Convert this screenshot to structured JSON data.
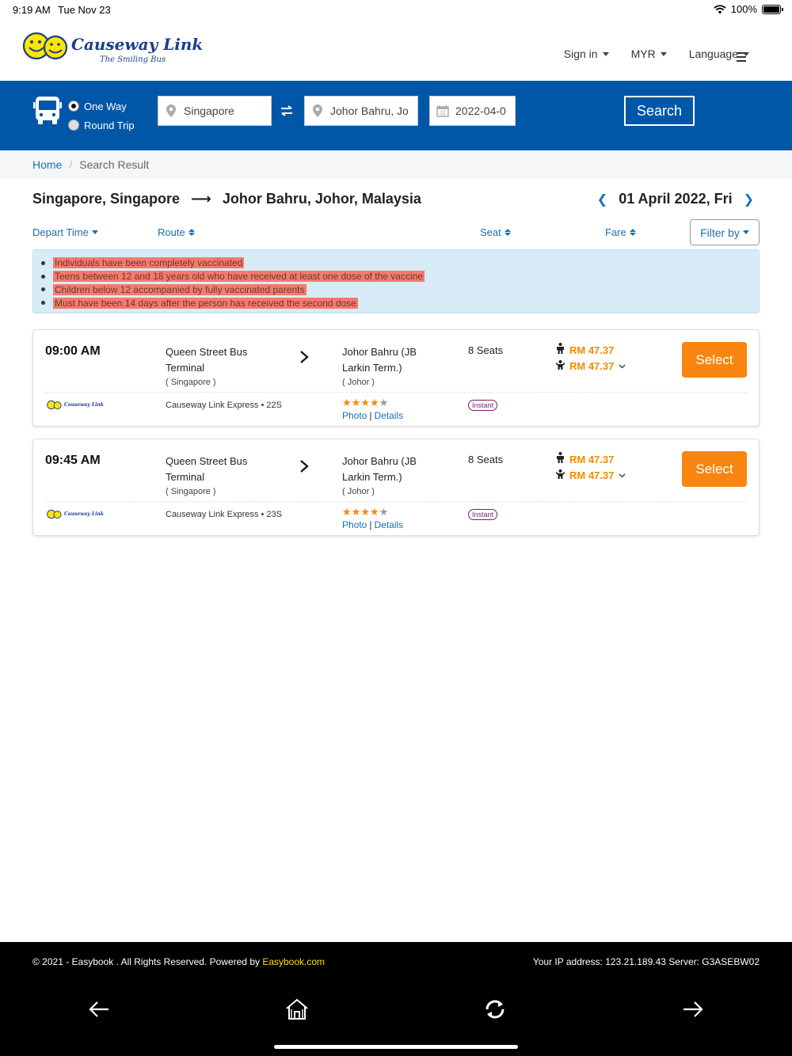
{
  "status_bar": {
    "time": "9:19 AM",
    "date": "Tue Nov 23",
    "battery": "100%"
  },
  "header": {
    "logo_brand": "Causeway Link",
    "logo_tagline": "The Smiling Bus",
    "nav": {
      "sign_in": "Sign in",
      "currency": "MYR",
      "language": "Language"
    }
  },
  "search": {
    "trip_options": {
      "one_way": "One Way",
      "round_trip": "Round Trip",
      "selected": "One Way"
    },
    "origin": "Singapore",
    "destination": "Johor Bahru, Jo",
    "date": "2022-04-0",
    "search_label": "Search",
    "accent": "#0057a8"
  },
  "breadcrumb": {
    "home": "Home",
    "current": "Search Result"
  },
  "route": {
    "from": "Singapore, Singapore",
    "arrow": "⟶",
    "to": "Johor Bahru, Johor, Malaysia",
    "date": "01 April 2022, Fri"
  },
  "sort": {
    "depart_time": "Depart Time",
    "route": "Route",
    "seat": "Seat",
    "fare": "Fare",
    "filter": "Filter by"
  },
  "notice": {
    "items": [
      "Individuals have been completely vaccinated",
      "Teens between 12 and 18 years old who have received at least one dose of the vaccine",
      "Children below 12 accompanied by fully vaccinated parents",
      "Must have been 14 days after the person has received the second dose"
    ]
  },
  "trips": [
    {
      "depart": "09:00 AM",
      "from_line1": "Queen Street Bus",
      "from_line2": "Terminal",
      "from_sub": "( Singapore )",
      "to_line1": "Johor Bahru (JB",
      "to_line2": "Larkin Term.)",
      "to_sub": "( Johor )",
      "seats": "8 Seats",
      "fare_adult": "RM 47.37",
      "fare_child": "RM 47.37",
      "select": "Select",
      "service": "Causeway Link Express • 22S",
      "rating": 4,
      "photo": "Photo",
      "details": "Details",
      "badge": "Instant"
    },
    {
      "depart": "09:45 AM",
      "from_line1": "Queen Street Bus",
      "from_line2": "Terminal",
      "from_sub": "( Singapore )",
      "to_line1": "Johor Bahru (JB",
      "to_line2": "Larkin Term.)",
      "to_sub": "( Johor )",
      "seats": "8 Seats",
      "fare_adult": "RM 47.37",
      "fare_child": "RM 47.37",
      "select": "Select",
      "service": "Causeway Link Express • 23S",
      "rating": 4,
      "photo": "Photo",
      "details": "Details",
      "badge": "Instant"
    }
  ],
  "footer": {
    "copyright": "© 2021 - Easybook . All Rights Reserved. Powered by ",
    "powered_link": "Easybook.com",
    "ip": "Your IP address: 123.21.189.43 Server: G3ASEBW02"
  },
  "toolbar_icons": [
    "back-arrow-icon",
    "home-icon",
    "refresh-icon",
    "forward-arrow-icon"
  ]
}
